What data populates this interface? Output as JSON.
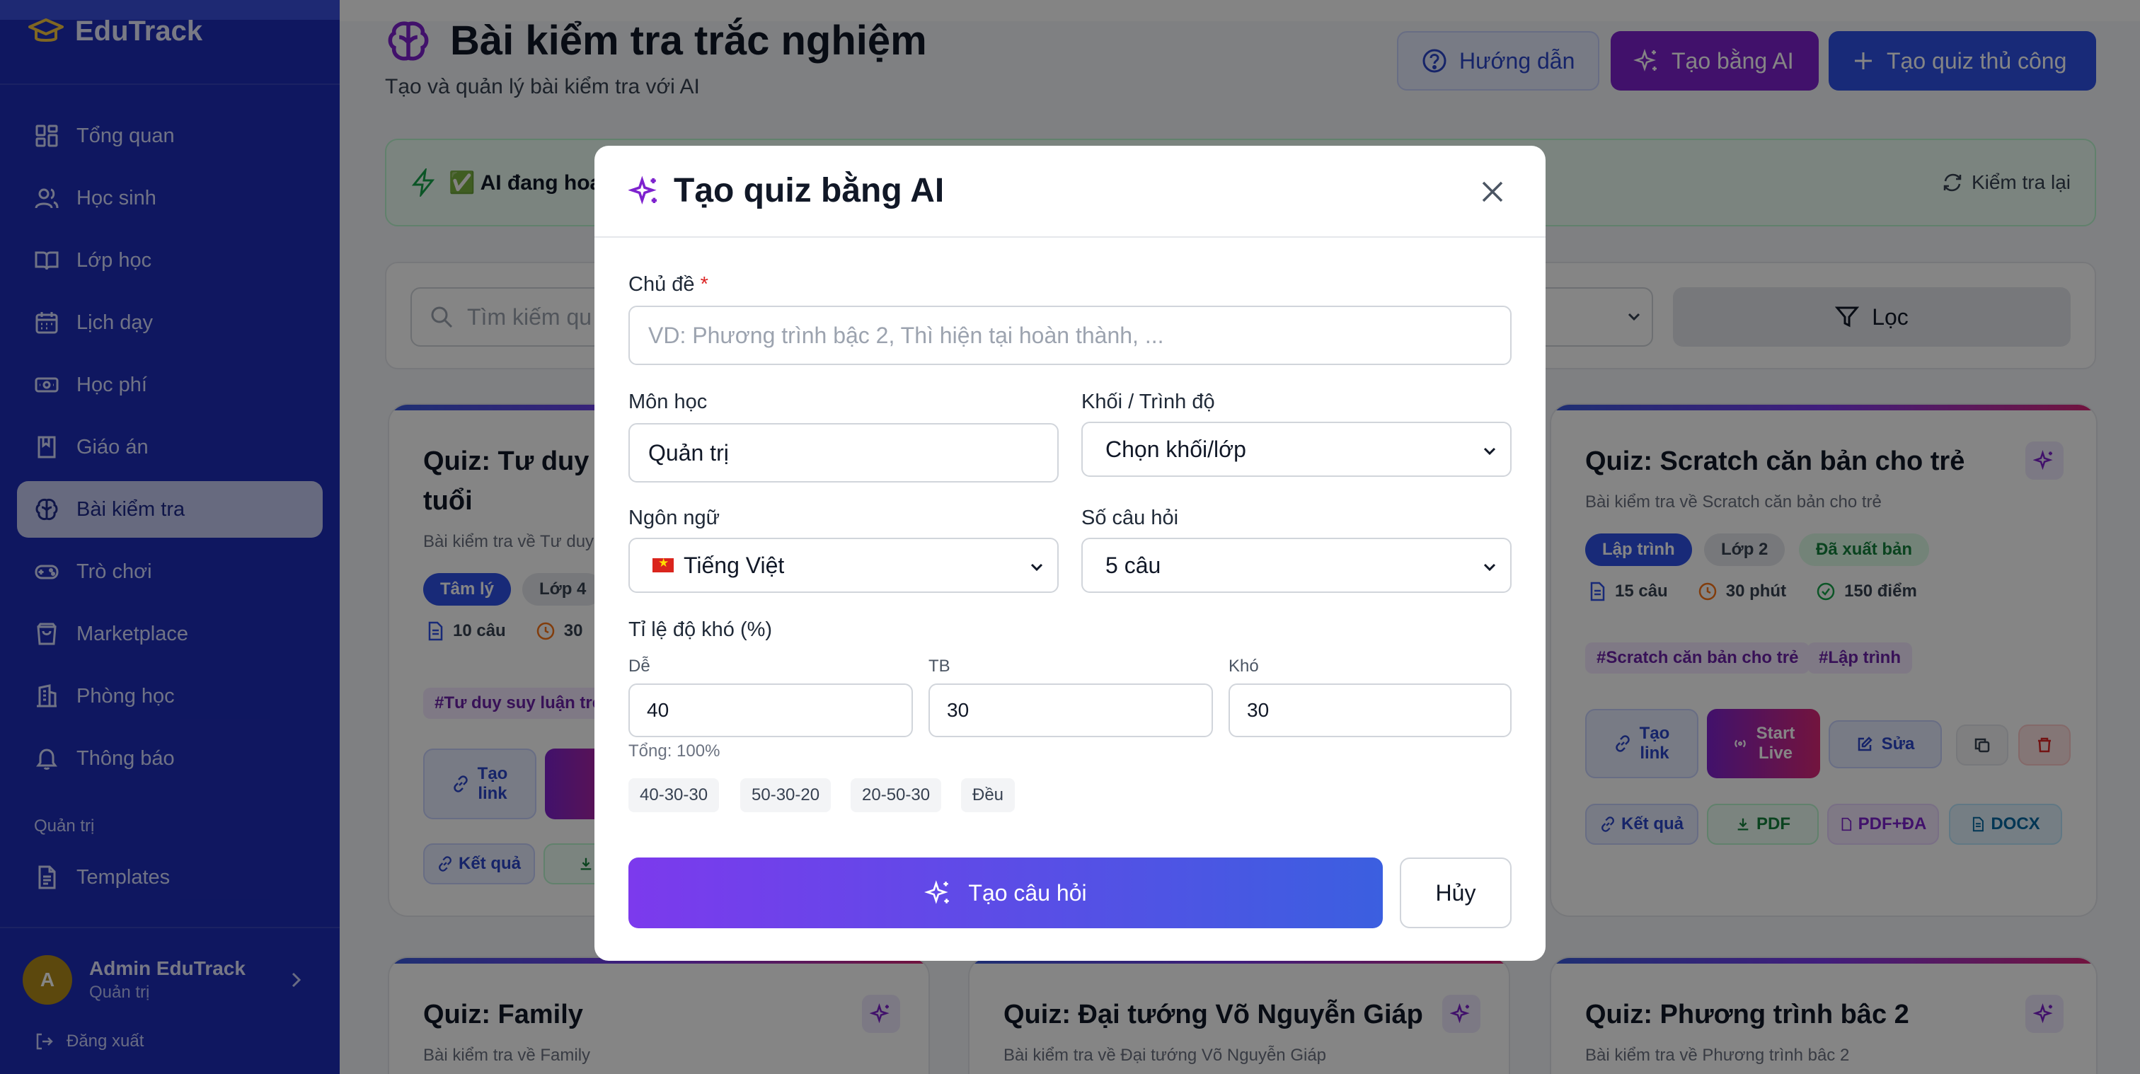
{
  "app": {
    "name": "EduTrack"
  },
  "sidebar": {
    "items": [
      {
        "label": "Tổng quan",
        "icon": "grid-icon"
      },
      {
        "label": "Học sinh",
        "icon": "users-icon"
      },
      {
        "label": "Lớp học",
        "icon": "book-open-icon"
      },
      {
        "label": "Lịch dạy",
        "icon": "calendar-icon"
      },
      {
        "label": "Học phí",
        "icon": "banknote-icon"
      },
      {
        "label": "Giáo án",
        "icon": "notebook-icon"
      },
      {
        "label": "Bài kiểm tra",
        "icon": "brain-icon",
        "active": true
      },
      {
        "label": "Trò chơi",
        "icon": "gamepad-icon"
      },
      {
        "label": "Marketplace",
        "icon": "shopping-bag-icon"
      },
      {
        "label": "Phòng học",
        "icon": "building-icon"
      },
      {
        "label": "Thông báo",
        "icon": "bell-icon"
      }
    ],
    "section_label": "Quản trị",
    "templates_label": "Templates",
    "user": {
      "initial": "A",
      "name": "Admin EduTrack",
      "role": "Quản trị"
    },
    "logout_label": "Đăng xuất"
  },
  "header": {
    "title": "Bài kiểm tra trắc nghiệm",
    "subtitle": "Tạo và quản lý bài kiểm tra với AI",
    "guide_label": "Hướng dẫn",
    "ai_label": "Tạo bằng AI",
    "manual_label": "Tạo quiz thủ công"
  },
  "ai_status": {
    "text": "✅ AI đang hoạ",
    "recheck_label": "Kiểm tra lại"
  },
  "filters": {
    "search_placeholder": "Tìm kiếm qu",
    "filter_label": "Lọc"
  },
  "cards": {
    "c1": {
      "title_line1": "Quiz: Tư duy s",
      "title_line2": "tuổi",
      "desc": "Bài kiểm tra về Tư duy",
      "pill1": "Tâm lý",
      "pill2": "Lớp 4",
      "questions": "10 câu",
      "minutes": "30",
      "tag": "#Tư duy suy luận tre",
      "link_l1": "Tạo",
      "link_l2": "link",
      "result_label": "Kết quả"
    },
    "c2": {
      "title": "Quiz: Scratch căn bản cho trẻ",
      "desc": "Bài kiểm tra về Scratch căn bản cho trẻ",
      "pill1": "Lập trình",
      "pill2": "Lớp 2",
      "pill3": "Đã xuất bản",
      "questions": "15 câu",
      "minutes": "30 phút",
      "points": "150 điểm",
      "tag1": "#Scratch căn bản cho trẻ",
      "tag2": "#Lập trình",
      "link_l1": "Tạo",
      "link_l2": "link",
      "live_l1": "Start",
      "live_l2": "Live",
      "edit_label": "Sửa",
      "result_label": "Kết quả",
      "pdf_label": "PDF",
      "pdfda_label": "PDF+ĐA",
      "docx_label": "DOCX"
    },
    "c3": {
      "title": "Quiz: Family",
      "desc": "Bài kiểm tra về Family"
    },
    "c4": {
      "title": "Quiz: Đại tướng Võ Nguyễn Giáp",
      "desc": "Bài kiểm tra về Đại tướng Võ Nguyễn Giáp"
    },
    "c5": {
      "title": "Quiz: Phương trình bâc 2",
      "desc": "Bài kiểm tra về Phương trình bâc 2"
    }
  },
  "modal": {
    "title": "Tạo quiz bằng AI",
    "topic_label": "Chủ đề",
    "required_mark": "*",
    "topic_placeholder": "VD: Phương trình bậc 2, Thì hiện tại hoàn thành, ...",
    "subject_label": "Môn học",
    "subject_value": "Quản trị",
    "grade_label": "Khối / Trình độ",
    "grade_value": "Chọn khối/lớp",
    "language_label": "Ngôn ngữ",
    "language_value": "Tiếng Việt",
    "count_label": "Số câu hỏi",
    "count_value": "5 câu",
    "difficulty_label": "Tỉ lệ độ khó (%)",
    "easy_label": "Dễ",
    "easy_value": "40",
    "medium_label": "TB",
    "medium_value": "30",
    "hard_label": "Khó",
    "hard_value": "30",
    "total_text": "Tổng: 100%",
    "presets": [
      "40-30-30",
      "50-30-20",
      "20-50-30",
      "Đều"
    ],
    "submit_label": "Tạo câu hỏi",
    "cancel_label": "Hủy"
  },
  "colors": {
    "sidebar": "#1e2cb8",
    "accent_purple": "#7e22ce",
    "accent_blue": "#2e52e6"
  }
}
